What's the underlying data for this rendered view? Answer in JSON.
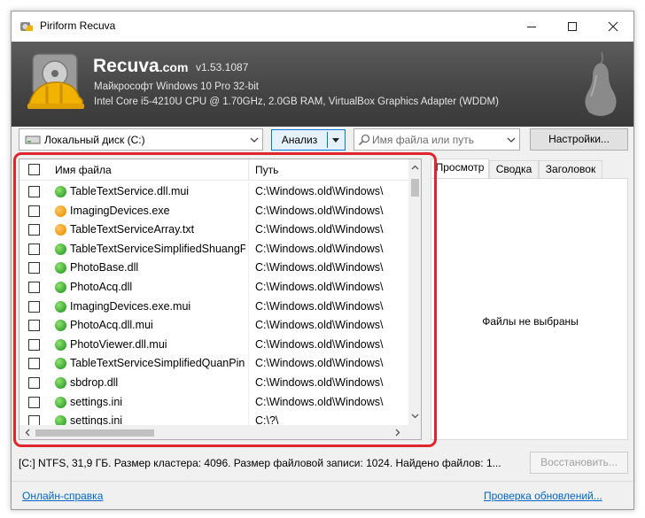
{
  "window": {
    "title": "Piriform Recuva",
    "icon": "recuva-app-icon"
  },
  "header": {
    "brand": "Recuva",
    "brand_suffix": ".com",
    "version": "v1.53.1087",
    "os_line": "Майкрософт Windows 10 Pro 32-bit",
    "hardware_line": "Intel Core i5-4210U CPU @ 1.70GHz, 2.0GB RAM, VirtualBox Graphics Adapter (WDDM)"
  },
  "toolbar": {
    "drive_label": "Локальный диск (C:)",
    "scan_label": "Анализ",
    "search_placeholder": "Имя файла или путь",
    "settings_label": "Настройки..."
  },
  "file_list": {
    "columns": {
      "name": "Имя файла",
      "path": "Путь"
    },
    "rows": [
      {
        "name": "TableTextService.dll.mui",
        "path": "C:\\Windows.old\\Windows\\",
        "state": "green"
      },
      {
        "name": "ImagingDevices.exe",
        "path": "C:\\Windows.old\\Windows\\",
        "state": "orange"
      },
      {
        "name": "TableTextServiceArray.txt",
        "path": "C:\\Windows.old\\Windows\\",
        "state": "orange"
      },
      {
        "name": "TableTextServiceSimplifiedShuangPin.txt",
        "path": "C:\\Windows.old\\Windows\\",
        "state": "green"
      },
      {
        "name": "PhotoBase.dll",
        "path": "C:\\Windows.old\\Windows\\",
        "state": "green"
      },
      {
        "name": "PhotoAcq.dll",
        "path": "C:\\Windows.old\\Windows\\",
        "state": "green"
      },
      {
        "name": "ImagingDevices.exe.mui",
        "path": "C:\\Windows.old\\Windows\\",
        "state": "green"
      },
      {
        "name": "PhotoAcq.dll.mui",
        "path": "C:\\Windows.old\\Windows\\",
        "state": "green"
      },
      {
        "name": "PhotoViewer.dll.mui",
        "path": "C:\\Windows.old\\Windows\\",
        "state": "green"
      },
      {
        "name": "TableTextServiceSimplifiedQuanPin.txt",
        "path": "C:\\Windows.old\\Windows\\",
        "state": "green"
      },
      {
        "name": "sbdrop.dll",
        "path": "C:\\Windows.old\\Windows\\",
        "state": "green"
      },
      {
        "name": "settings.ini",
        "path": "C:\\Windows.old\\Windows\\",
        "state": "green"
      },
      {
        "name": "settings.ini",
        "path": "C:\\?\\",
        "state": "green"
      }
    ]
  },
  "preview": {
    "tabs": [
      "Просмотр",
      "Сводка",
      "Заголовок"
    ],
    "active_tab": "Просмотр",
    "empty_text": "Файлы не выбраны"
  },
  "status": {
    "text": "[C:] NTFS, 31,9 ГБ. Размер кластера: 4096. Размер файловой записи: 1024. Найдено файлов: 1..."
  },
  "actions": {
    "restore_label": "Восстановить..."
  },
  "footer": {
    "help_link": "Онлайн-справка",
    "update_link": "Проверка обновлений..."
  },
  "colors": {
    "state_green": "#3aa832",
    "state_orange": "#f09a10",
    "highlight": "#e0262d",
    "link": "#0066cc"
  }
}
